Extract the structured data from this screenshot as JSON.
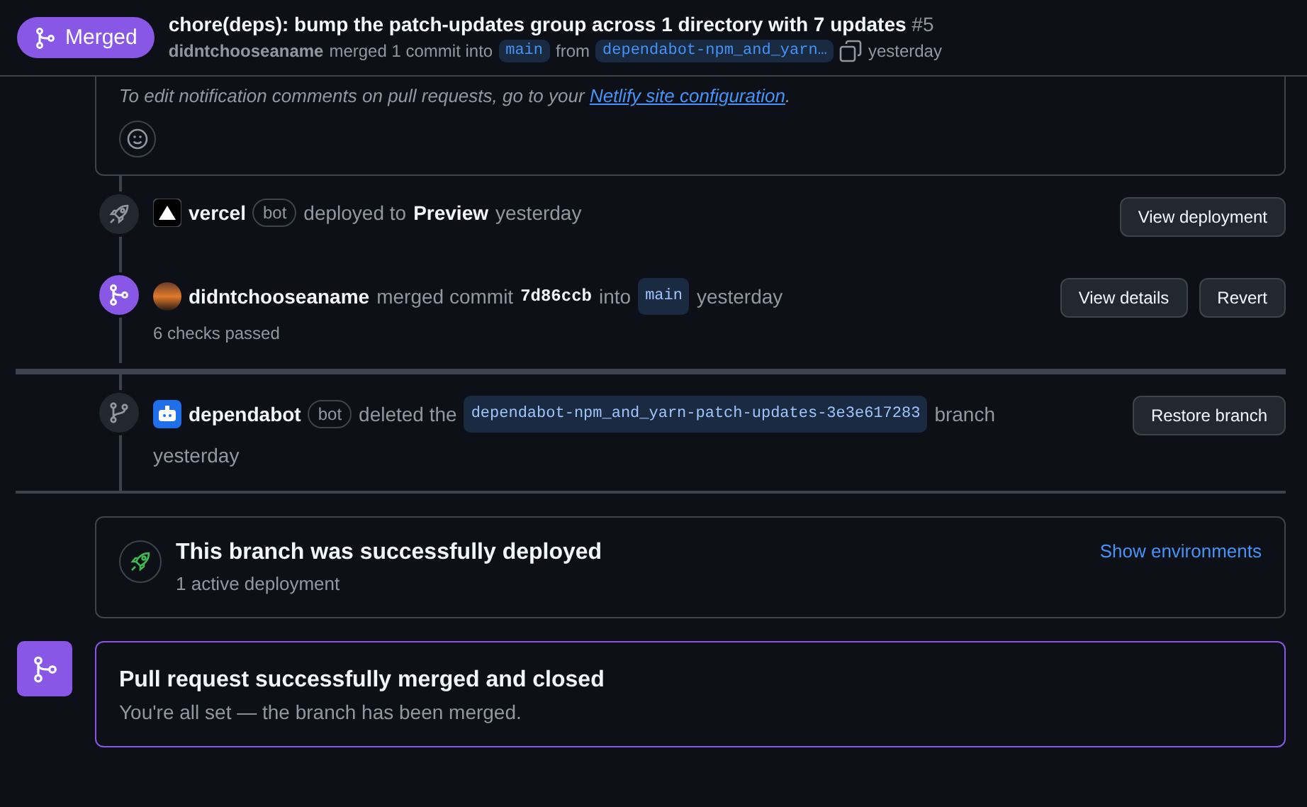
{
  "header": {
    "state_label": "Merged",
    "title": "chore(deps): bump the patch-updates group across 1 directory with 7 updates",
    "number": "#5",
    "author": "didntchooseaname",
    "action": "merged 1 commit into",
    "base": "main",
    "from": "from",
    "head": "dependabot-npm_and_yarn…",
    "time": "yesterday"
  },
  "comment": {
    "text": "To edit notification comments on pull requests, go to your ",
    "link": "Netlify site configuration",
    "after": "."
  },
  "events": [
    {
      "kind": "deploy",
      "avatar": {
        "kind": "vercel"
      },
      "parts": [
        {
          "kind": "actor",
          "text": "vercel"
        },
        {
          "kind": "badge",
          "text": "bot"
        },
        {
          "kind": "text",
          "text": "deployed to"
        },
        {
          "kind": "strong",
          "text": "Preview"
        },
        {
          "kind": "text",
          "text": "yesterday"
        }
      ],
      "buttons": [
        "View deployment"
      ]
    },
    {
      "kind": "merge",
      "avatar": {
        "kind": "user"
      },
      "parts": [
        {
          "kind": "actor",
          "text": "didntchooseaname"
        },
        {
          "kind": "text",
          "text": "merged commit"
        },
        {
          "kind": "commit",
          "text": "7d86ccb"
        },
        {
          "kind": "text",
          "text": "into"
        },
        {
          "kind": "branch",
          "text": "main"
        },
        {
          "kind": "text",
          "text": "yesterday"
        }
      ],
      "subtext": "6 checks passed",
      "buttons": [
        "View details",
        "Revert"
      ],
      "divider": {
        "kind": "thick"
      }
    },
    {
      "kind": "delete",
      "avatar": {
        "kind": "bot"
      },
      "parts": [
        {
          "kind": "actor",
          "text": "dependabot"
        },
        {
          "kind": "badge",
          "text": "bot"
        },
        {
          "kind": "text",
          "text": "deleted the"
        },
        {
          "kind": "branch",
          "text": "dependabot-npm_and_yarn-patch-updates-3e3e617283"
        },
        {
          "kind": "text",
          "text": "branch"
        },
        {
          "kind": "text",
          "text": "yesterday"
        }
      ],
      "buttons": [
        "Restore branch"
      ],
      "divider": {
        "kind": "thin"
      }
    }
  ],
  "deployment": {
    "title": "This branch was successfully deployed",
    "subtitle": "1 active deployment",
    "link": "Show environments"
  },
  "merged_box": {
    "title": "Pull request successfully merged and closed",
    "subtitle": "You're all set — the branch has been merged."
  }
}
